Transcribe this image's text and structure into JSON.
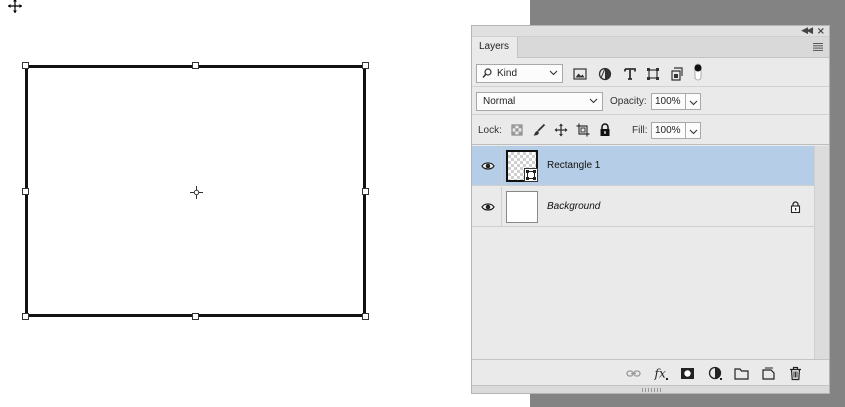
{
  "panel": {
    "tab_label": "Layers",
    "filter": {
      "kind_label": "Kind"
    },
    "blend": {
      "mode": "Normal",
      "opacity_label": "Opacity:",
      "opacity_value": "100%"
    },
    "lock": {
      "lock_label": "Lock:",
      "fill_label": "Fill:",
      "fill_value": "100%"
    },
    "layers": [
      {
        "name": "Rectangle 1",
        "selected": true,
        "visible": true,
        "type": "shape"
      },
      {
        "name": "Background",
        "selected": false,
        "visible": true,
        "locked": true,
        "type": "background"
      }
    ],
    "bottom_icons": [
      "link-icon",
      "fx-icon",
      "mask-icon",
      "adjustment-icon",
      "folder-icon",
      "new-layer-icon",
      "trash-icon"
    ]
  },
  "colors": {
    "selected_row": "#b5cde6",
    "canvas_bg": "#ffffff",
    "workspace_bg": "#838383",
    "panel_bg": "#eaeaea"
  }
}
